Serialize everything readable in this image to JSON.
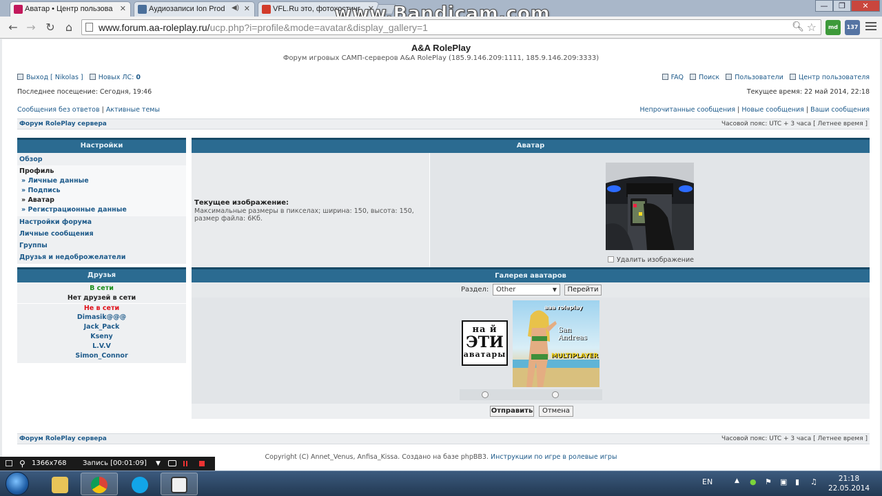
{
  "browser": {
    "tabs": [
      {
        "title": "Аватар • Центр пользова",
        "close": "✕"
      },
      {
        "title": "Аудиозаписи Ion Prod",
        "close": "✕",
        "sound": "◀)"
      },
      {
        "title": "VFL.Ru это, фотохостинг",
        "close": "✕"
      }
    ],
    "watermark": "www.Bandicam.com",
    "window_controls": {
      "minimize": "—",
      "maximize": "❐",
      "close": "✕"
    },
    "url_host": "www.forum.aa-roleplay.ru/",
    "url_rest": "ucp.php?i=profile&mode=avatar&display_gallery=1",
    "ext_badges": [
      "md",
      "137"
    ],
    "icons": {
      "back": "arrow-left-icon",
      "forward": "arrow-right-icon",
      "reload": "reload-icon",
      "home": "home-icon",
      "zoom": "zoom-icon",
      "bookmark": "star-icon",
      "menu": "menu-icon"
    }
  },
  "header": {
    "title": "A&A RolePlay",
    "description": "Форум игровых САМП-серверов A&A RolePlay (185.9.146.209:1111, 185.9.146.209:3333)",
    "logout": "Выход [ Nikolas ]",
    "new_pm_label": "Новых ЛС:",
    "new_pm_count": "0",
    "faq": "FAQ",
    "search": "Поиск",
    "members": "Пользователи",
    "ucp": "Центр пользователя",
    "last_visit": "Последнее посещение: Сегодня, 19:46",
    "current_time": "Текущее время: 22 май 2014, 22:18",
    "unanswered": "Сообщения без ответов",
    "active": "Активные темы",
    "unread": "Непрочитанные сообщения",
    "new_posts": "Новые сообщения",
    "your_posts": "Ваши сообщения",
    "sep": "|"
  },
  "breadcrumb": {
    "forum": "Форум RolePlay сервера",
    "timezone": "Часовой пояс: UTC + 3 часа [ Летнее время ]"
  },
  "sidebar": {
    "title": "Настройки",
    "overview": "Обзор",
    "profile": "Профиль",
    "profile_items": [
      "» Личные данные",
      "» Подпись",
      "» Аватар",
      "» Регистрационные данные"
    ],
    "items": [
      "Настройки форума",
      "Личные сообщения",
      "Группы",
      "Друзья и недоброжелатели"
    ]
  },
  "friends": {
    "title": "Друзья",
    "online_label": "В сети",
    "online_none": "Нет друзей в сети",
    "offline_label": "Не в сети",
    "offline": [
      "Dimasik@@@",
      "Jack_Pack",
      "Kseny",
      "L.V.V",
      "Simon_Connor"
    ],
    "online_color": "#1a8c1a",
    "offline_color": "#e0121b"
  },
  "avatar": {
    "title": "Аватар",
    "current_label": "Текущее изображение:",
    "hint": "Максимальные размеры в пикселах; ширина: 150, высота: 150, размер файла: 6Кб.",
    "delete": "Удалить изображение"
  },
  "gallery": {
    "title": "Галерея аватаров",
    "section_label": "Раздел:",
    "section_value": "Other",
    "go": "Перейти",
    "img1": {
      "line1": "на й",
      "line2": "ЭТИ",
      "line3": "аватары"
    },
    "img2": {
      "top": "aaa roleplay",
      "mid": "San Andreas",
      "bottom": "MULTIPLAYER"
    },
    "submit": "Отправить",
    "cancel": "Отмена"
  },
  "footer": {
    "forum": "Форум RolePlay сервера",
    "timezone": "Часовой пояс: UTC + 3 часа [ Летнее время ]",
    "copyright": "Copyright (C) Annet_Venus, Anfisa_Kissa. Создано на базе phpBB3.",
    "instructions": "Инструкции по игре в ролевые игры"
  },
  "recorder": {
    "resolution": "1366x768",
    "status": "Запись [00:01:09]"
  },
  "taskbar": {
    "lang": "EN",
    "time": "21:18",
    "date": "22.05.2014"
  },
  "colors": {
    "accent": "#2b6b91",
    "link": "#1d5a8a",
    "panel_bg": "#eef0f2"
  }
}
